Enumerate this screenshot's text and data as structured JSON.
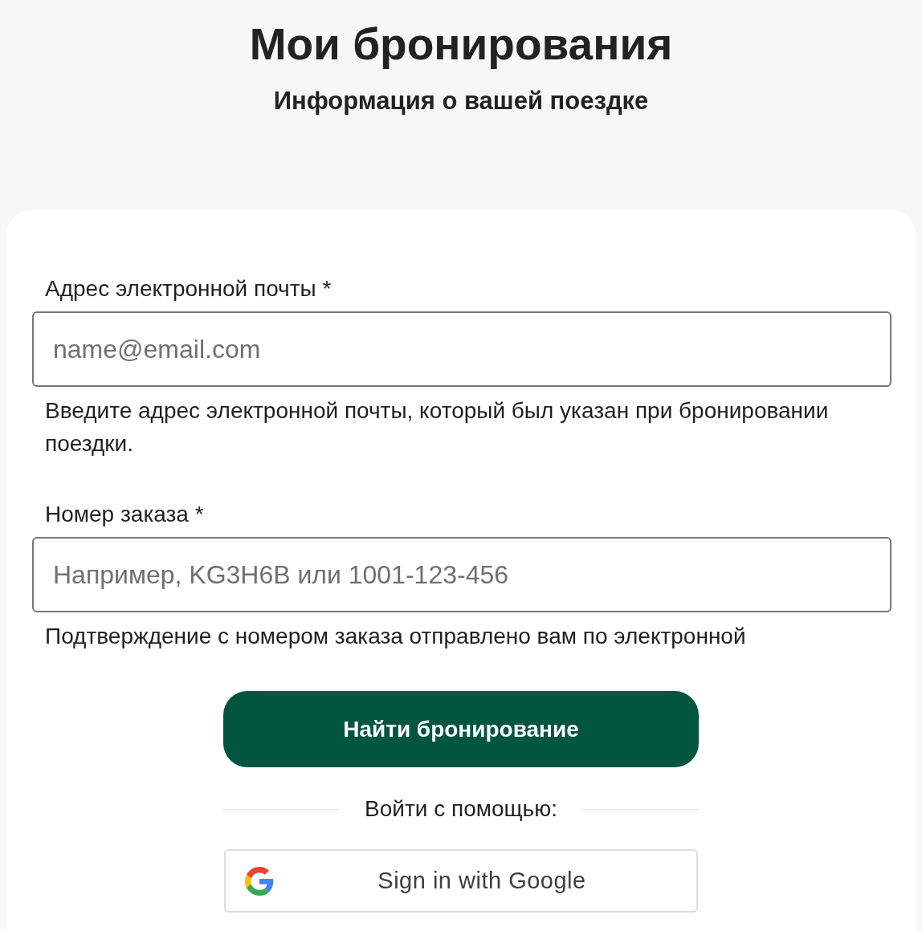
{
  "header": {
    "title": "Мои бронирования",
    "subtitle": "Информация о вашей поездке"
  },
  "form": {
    "fields": [
      {
        "label": "Адрес электронной почты *",
        "placeholder": "name@email.com",
        "hint": "Введите адрес электронной почты, который был указан при бронировании поездки."
      },
      {
        "label": "Номер заказа *",
        "placeholder": "Например, KG3H6B или 1001-123-456",
        "hint": "Подтверждение с номером заказа отправлено вам по электронной"
      }
    ],
    "submit_button": {
      "label": "Найти бронирование"
    },
    "divider": {
      "label": "Войти с помощью:"
    },
    "social_buttons": [
      {
        "kind": "google",
        "label": "Sign in with Google"
      }
    ]
  }
}
